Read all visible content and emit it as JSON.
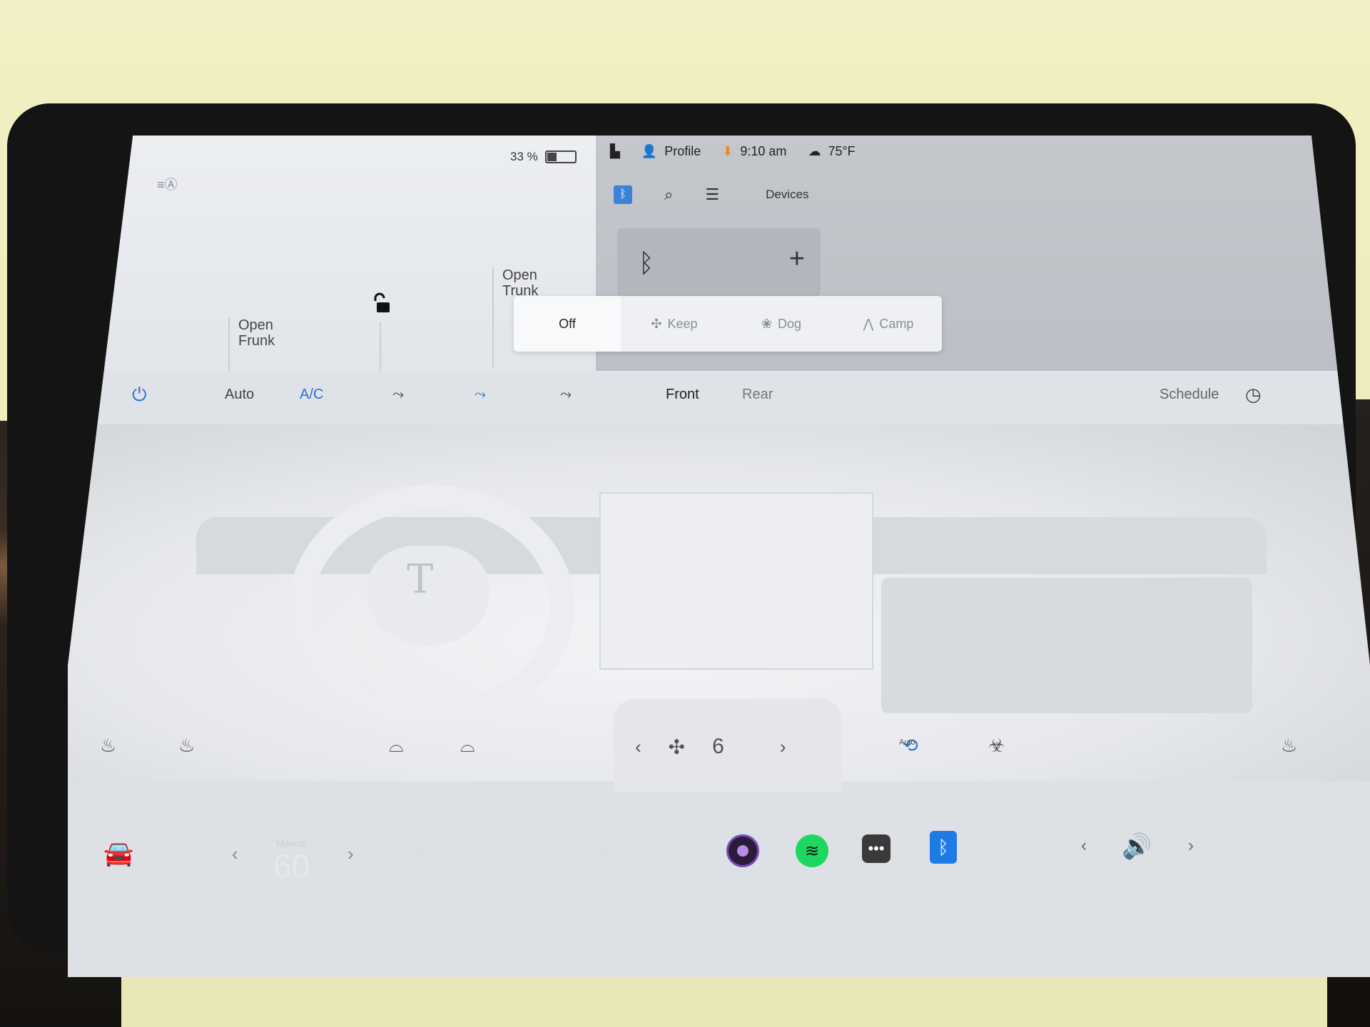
{
  "car": {
    "battery_percent": "33 %",
    "battery_level": 0.33,
    "open_frunk_line1": "Open",
    "open_frunk_line2": "Frunk",
    "open_trunk_line1": "Open",
    "open_trunk_line2": "Trunk"
  },
  "status_bar": {
    "profile": "Profile",
    "time": "9:10 am",
    "temperature": "75°F"
  },
  "media": {
    "devices_label": "Devices"
  },
  "climate_mode": {
    "options": [
      "Off",
      "Keep",
      "Dog",
      "Camp"
    ],
    "selected": "Off"
  },
  "climate": {
    "auto": "Auto",
    "ac": "A/C",
    "front": "Front",
    "rear": "Rear",
    "schedule": "Schedule",
    "fan_speed": "6",
    "recirc_auto": "Auto"
  },
  "dock": {
    "temp_mode": "Manual",
    "temp_value": "60"
  },
  "colors": {
    "accent_blue": "#2e6fd6",
    "bluetooth_blue": "#1e7be6",
    "spotify_green": "#1ed760"
  }
}
